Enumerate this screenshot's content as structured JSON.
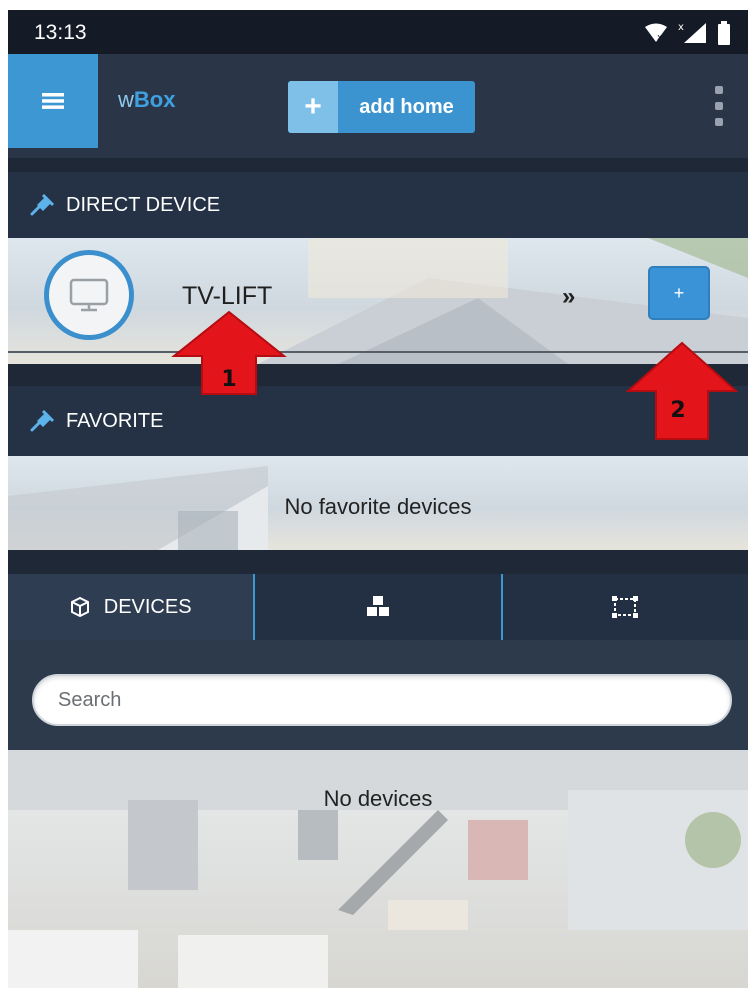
{
  "status_bar": {
    "time": "13:13"
  },
  "app_bar": {
    "title_prefix": "w",
    "title_suffix": "Box",
    "add_home_label": "add home",
    "add_home_plus": "+"
  },
  "direct_device": {
    "header": "DIRECT DEVICE",
    "device": {
      "name": "TV-LIFT",
      "arrow": "»",
      "add_label": "+"
    }
  },
  "favorite": {
    "header": "FAVORITE",
    "empty_text": "No favorite devices"
  },
  "tabs": [
    {
      "label": "DEVICES",
      "icon": "cube-icon",
      "active": true
    },
    {
      "label": "",
      "icon": "cubes-icon",
      "active": false
    },
    {
      "label": "",
      "icon": "group-select-icon",
      "active": false
    }
  ],
  "search": {
    "placeholder": "Search"
  },
  "devices": {
    "empty_text": "No devices"
  },
  "annotations": [
    {
      "number": "1",
      "color": "#e4141b"
    },
    {
      "number": "2",
      "color": "#e4141b"
    }
  ],
  "colors": {
    "accent": "#3c97d3",
    "panel_dark": "#232e3e",
    "arrow_red": "#e4141b"
  }
}
